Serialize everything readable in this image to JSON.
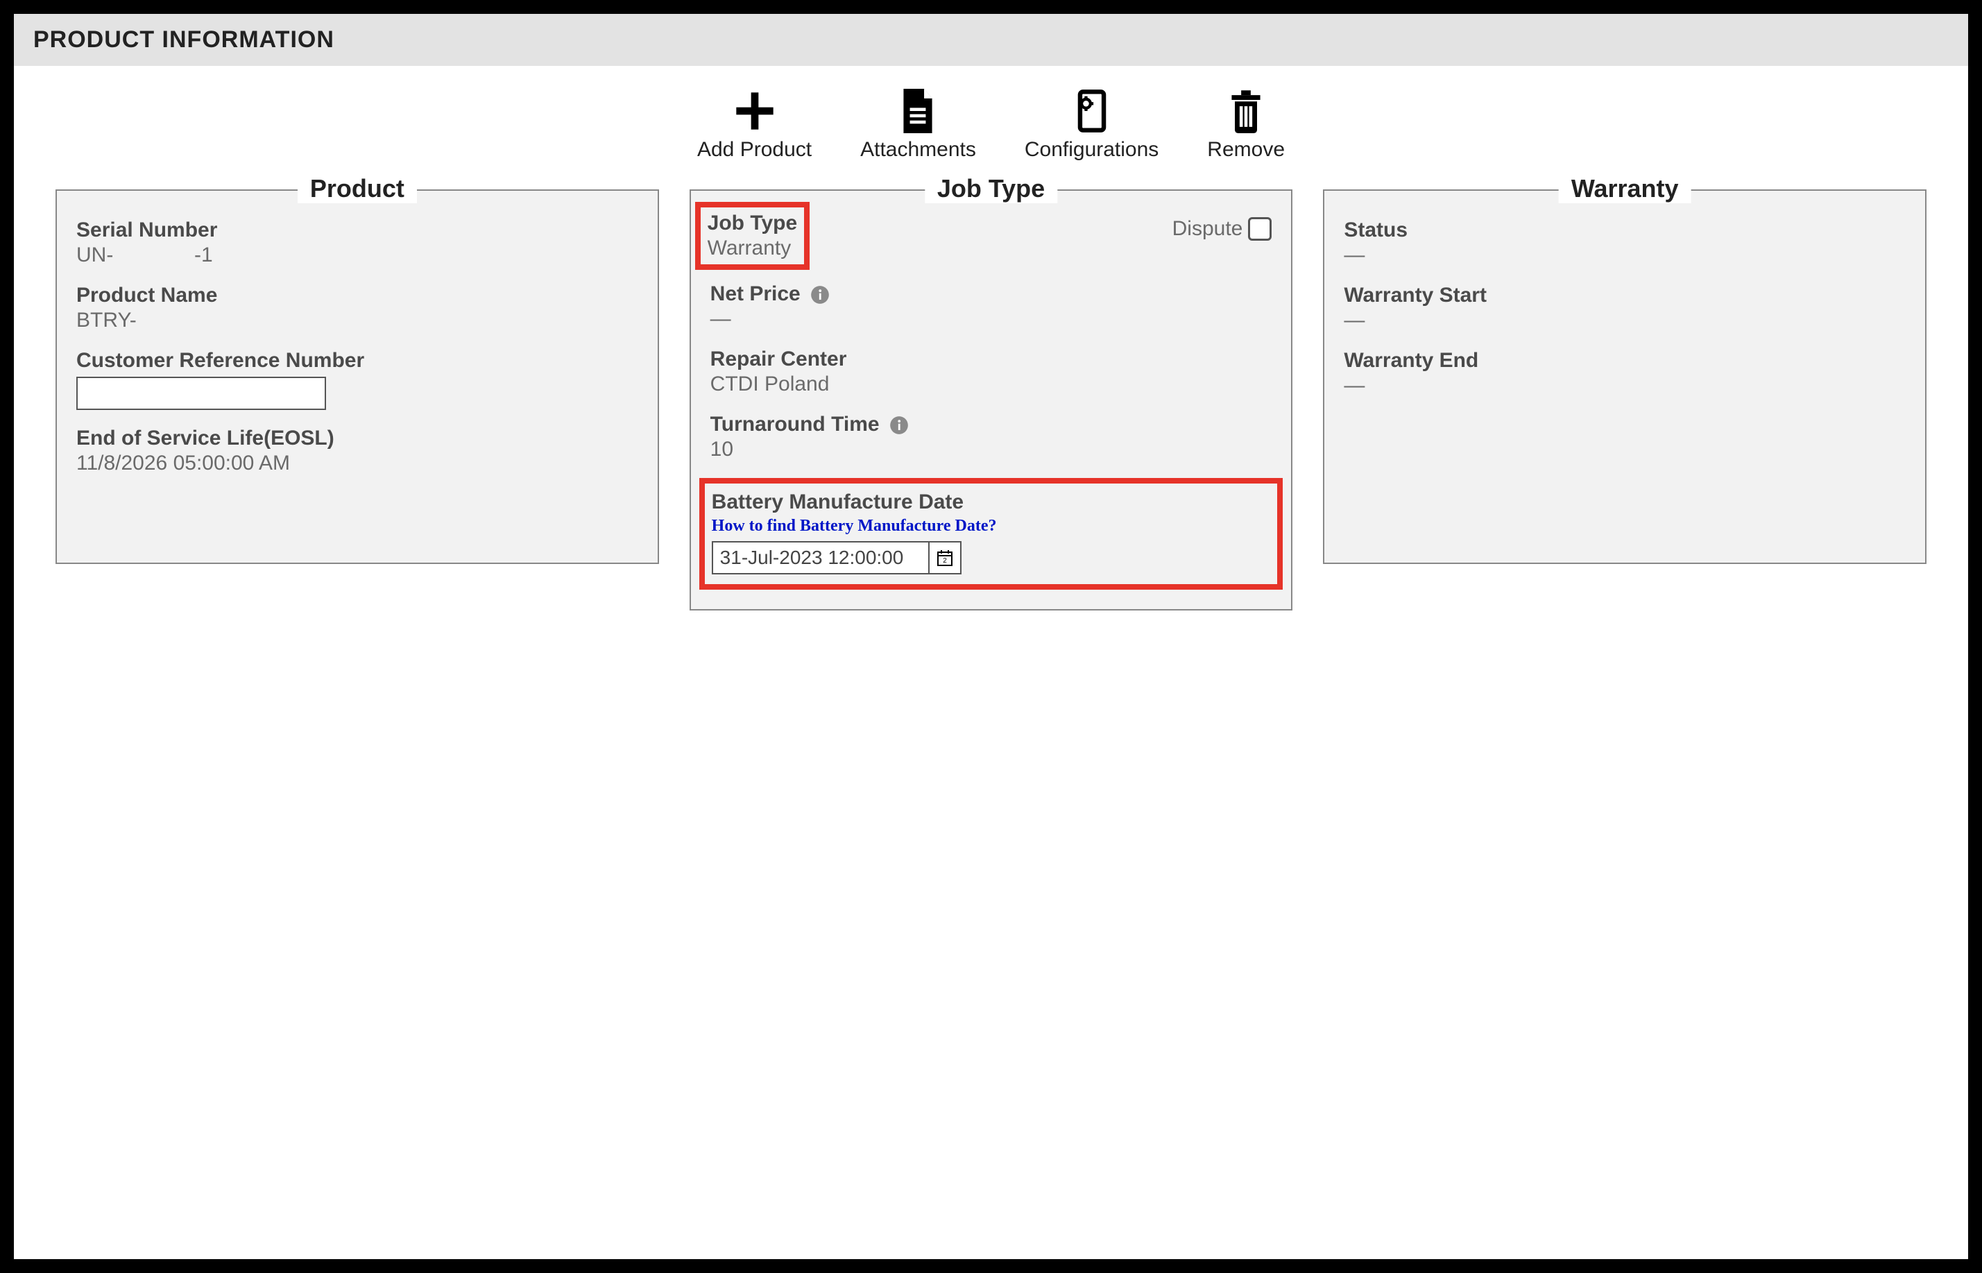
{
  "header": {
    "title": "PRODUCT INFORMATION"
  },
  "toolbar": {
    "add": "Add Product",
    "attachments": "Attachments",
    "configurations": "Configurations",
    "remove": "Remove"
  },
  "product": {
    "legend": "Product",
    "serial_label": "Serial Number",
    "serial_value": "UN-              -1",
    "name_label": "Product Name",
    "name_value": "BTRY-",
    "crn_label": "Customer Reference Number",
    "crn_value": "",
    "eosl_label": "End of Service Life(EOSL)",
    "eosl_value": "11/8/2026 05:00:00 AM"
  },
  "jobtype": {
    "legend": "Job Type",
    "jobtype_label": "Job Type",
    "jobtype_value": "Warranty",
    "dispute_label": "Dispute",
    "netprice_label": "Net Price",
    "netprice_value": "—",
    "repair_label": "Repair Center",
    "repair_value": "CTDI Poland",
    "turnaround_label": "Turnaround Time",
    "turnaround_value": "10",
    "battery_label": "Battery Manufacture Date",
    "battery_help": "How to find Battery Manufacture Date?",
    "battery_value": "31-Jul-2023 12:00:00"
  },
  "warranty": {
    "legend": "Warranty",
    "status_label": "Status",
    "status_value": "—",
    "start_label": "Warranty Start",
    "start_value": "—",
    "end_label": "Warranty End",
    "end_value": "—"
  }
}
